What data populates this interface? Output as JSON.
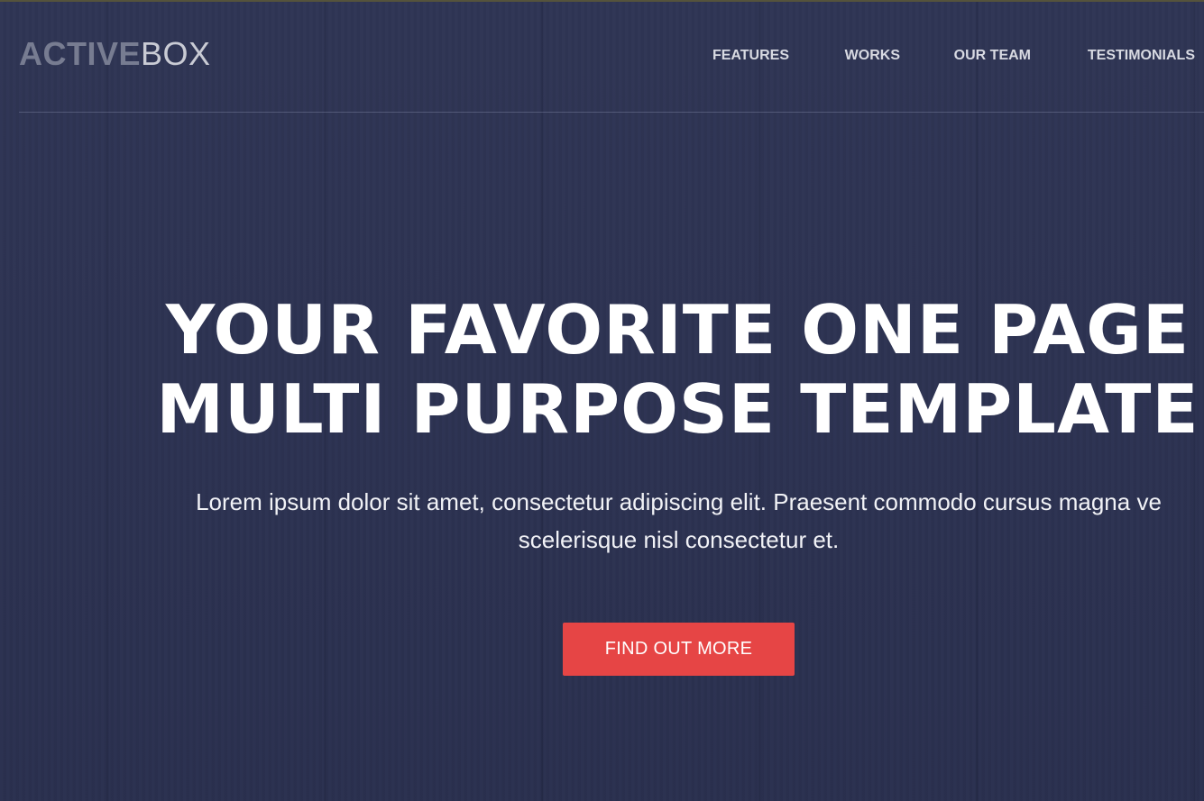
{
  "header": {
    "logo": {
      "part_bold": "ACTIVE",
      "part_light": "BOX"
    },
    "nav": {
      "items": [
        {
          "label": "FEATURES"
        },
        {
          "label": "WORKS"
        },
        {
          "label": "OUR TEAM"
        },
        {
          "label": "TESTIMONIALS"
        }
      ]
    }
  },
  "hero": {
    "headline_line1": "YOUR FAVORITE ONE PAGE",
    "headline_line2": "MULTI PURPOSE TEMPLATE",
    "lede_line1": "Lorem ipsum dolor sit amet, consectetur adipiscing elit. Praesent commodo cursus magna ve",
    "lede_line2": "scelerisque nisl consectetur et.",
    "cta_label": "FIND OUT MORE"
  },
  "colors": {
    "background": "#2c3252",
    "accent": "#e64545",
    "logo_bold": "#777c91",
    "logo_light": "#c9cbd4",
    "nav_text": "#d8dae2",
    "headline": "#ffffff"
  }
}
